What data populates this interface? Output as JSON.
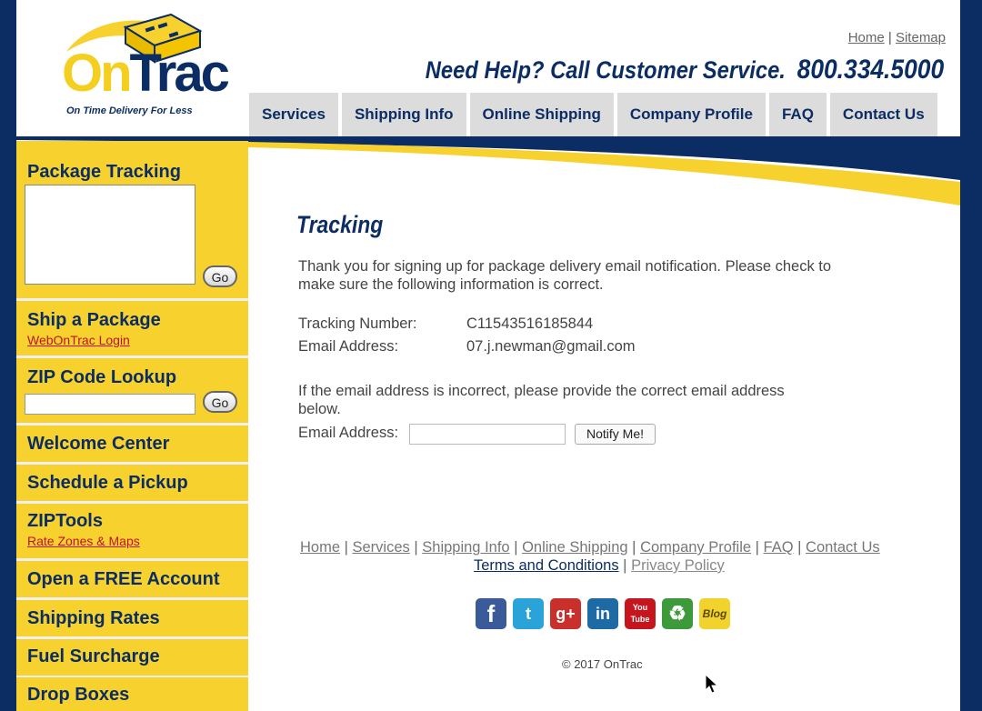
{
  "header": {
    "logo": {
      "on": "On",
      "trac": "Trac",
      "tagline": "On Time Delivery For Less"
    },
    "toplinks": {
      "home": "Home",
      "sep": "|",
      "sitemap": "Sitemap"
    },
    "help": {
      "message": "Need Help?  Call Customer Service.",
      "phone": "800.334.5000"
    },
    "nav": [
      "Services",
      "Shipping Info",
      "Online Shipping",
      "Company Profile",
      "FAQ",
      "Contact Us"
    ]
  },
  "sidebar": {
    "tracking_title": "Package Tracking",
    "go_label": "Go",
    "ship_title": "Ship a Package",
    "ship_sub": "WebOnTrac Login",
    "zip_title": "ZIP Code Lookup",
    "welcome": "Welcome Center",
    "schedule": "Schedule a Pickup",
    "ziptools_title": "ZIPTools",
    "ziptools_sub": "Rate Zones & Maps",
    "open_account": "Open a FREE Account",
    "shipping_rates": "Shipping Rates",
    "fuel": "Fuel Surcharge",
    "drop": "Drop Boxes"
  },
  "main": {
    "title": "Tracking",
    "intro": "Thank you for signing up for package delivery email notification. Please check to make sure the following information is correct.",
    "tracking_label": "Tracking Number:",
    "tracking_value": "C11543516185844",
    "email_label": "Email Address:",
    "email_value": "07.j.newman@gmail.com",
    "correction_msg": "If the email address is incorrect, please provide the correct email address below.",
    "email_input_label": "Email Address:",
    "notify_label": "Notify Me!"
  },
  "footer": {
    "links": [
      "Home",
      "Services",
      "Shipping Info",
      "Online Shipping",
      "Company Profile",
      "FAQ",
      "Contact Us"
    ],
    "terms": "Terms and Conditions",
    "privacy": "Privacy Policy",
    "separator": "|",
    "social": [
      {
        "icon": "facebook-icon",
        "glyph": "f",
        "color": "#3b5a9a"
      },
      {
        "icon": "twitter-icon",
        "glyph": "t",
        "color": "#2aa3d8"
      },
      {
        "icon": "google-plus-icon",
        "glyph": "g+",
        "color": "#c9302c"
      },
      {
        "icon": "linkedin-icon",
        "glyph": "in",
        "color": "#1d6aa5"
      },
      {
        "icon": "youtube-icon",
        "glyph": "You Tube",
        "color": "#c4161c"
      },
      {
        "icon": "recycle-icon",
        "glyph": "♻",
        "color": "#3c9a3a"
      },
      {
        "icon": "blog-icon",
        "glyph": "Blog",
        "color": "#f2d22c"
      }
    ],
    "copyright": "© 2017 OnTrac"
  },
  "colors": {
    "navy": "#0b2d63",
    "yellow": "#f7d22e",
    "link_red": "#c0102a"
  }
}
